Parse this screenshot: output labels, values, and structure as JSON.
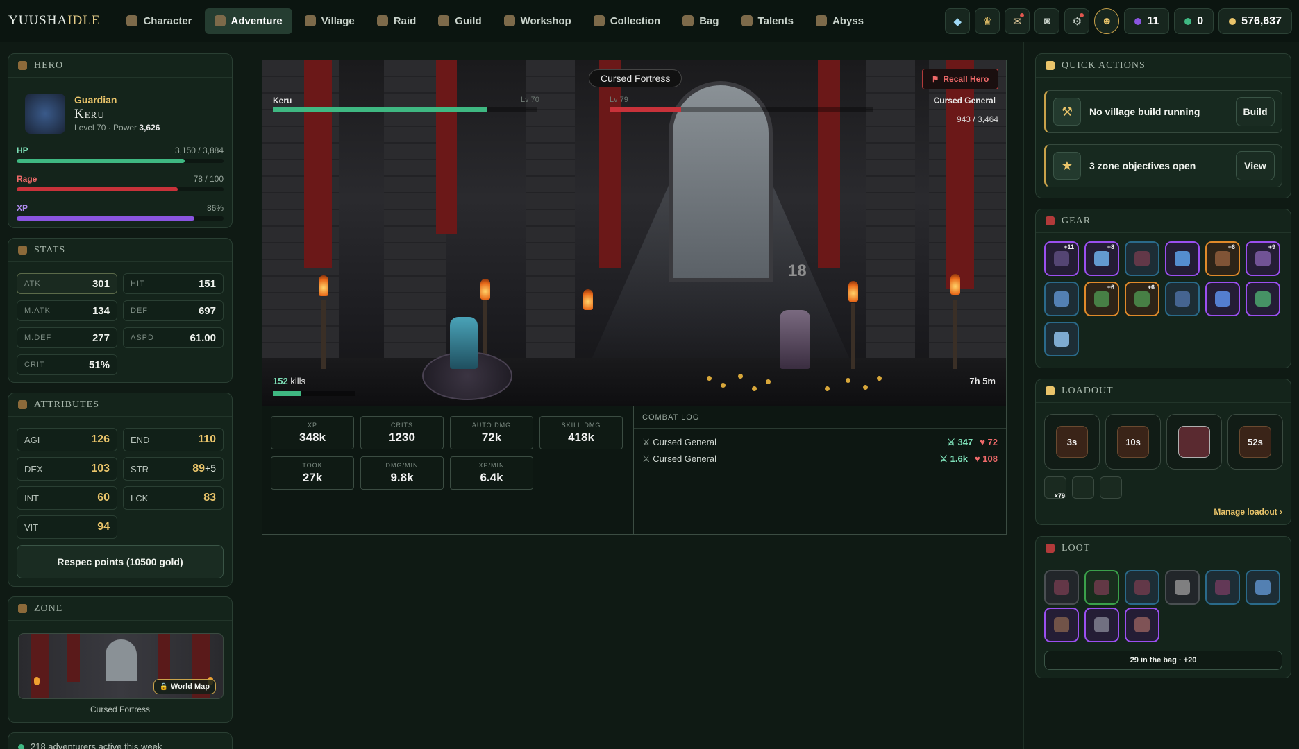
{
  "nav": {
    "logo_main": "YUUSHA",
    "logo_accent": "IDLE",
    "items": [
      {
        "label": "Character",
        "icon": "character-icon"
      },
      {
        "label": "Adventure",
        "icon": "sword-icon",
        "active": true
      },
      {
        "label": "Village",
        "icon": "hammer-icon"
      },
      {
        "label": "Raid",
        "icon": "skull-icon"
      },
      {
        "label": "Guild",
        "icon": "shield-icon"
      },
      {
        "label": "Workshop",
        "icon": "anvil-icon"
      },
      {
        "label": "Collection",
        "icon": "book-icon"
      },
      {
        "label": "Bag",
        "icon": "bag-icon"
      },
      {
        "label": "Talents",
        "icon": "tree-icon"
      },
      {
        "label": "Abyss",
        "icon": "portal-icon"
      }
    ],
    "right": {
      "icons": [
        "diamond-icon",
        "trophy-icon",
        "mail-icon",
        "discord-icon",
        "settings-icon",
        "avatar-icon"
      ],
      "crystals": "11",
      "gems": "0",
      "gold": "576,637"
    }
  },
  "hero": {
    "section_title": "HERO",
    "class": "Guardian",
    "name": "Keru",
    "level_text": "Level 70 · Power",
    "power": "3,626",
    "hp_label": "HP",
    "hp_value": "3,150 / 3,884",
    "hp_fraction": 0.811,
    "rage_label": "Rage",
    "rage_value": "78 / 100",
    "rage_fraction": 0.78,
    "xp_label": "XP",
    "xp_value": "86%",
    "xp_fraction": 0.86
  },
  "stats": {
    "section_title": "STATS",
    "items": [
      {
        "k": "ATK",
        "v": "301"
      },
      {
        "k": "HIT",
        "v": "151"
      },
      {
        "k": "M.ATK",
        "v": "134"
      },
      {
        "k": "DEF",
        "v": "697"
      },
      {
        "k": "M.DEF",
        "v": "277"
      },
      {
        "k": "ASPD",
        "v": "61.00"
      },
      {
        "k": "CRIT",
        "v": "51%"
      }
    ]
  },
  "attributes": {
    "section_title": "ATTRIBUTES",
    "items": [
      {
        "k": "AGI",
        "v": "126"
      },
      {
        "k": "END",
        "v": "110"
      },
      {
        "k": "DEX",
        "v": "103"
      },
      {
        "k": "STR",
        "v": "89",
        "bonus": "+5"
      },
      {
        "k": "INT",
        "v": "60"
      },
      {
        "k": "LCK",
        "v": "83"
      },
      {
        "k": "VIT",
        "v": "94"
      }
    ],
    "respec_label": "Respec points (10500 gold)"
  },
  "zone": {
    "section_title": "ZONE",
    "world_map_label": "World Map",
    "zone_name": "Cursed Fortress"
  },
  "footer_note": "218 adventurers active this week",
  "battle": {
    "zone_title": "Cursed Fortress",
    "recall_label": "Recall Hero",
    "hero_name": "Keru",
    "hero_level": "Lv 70",
    "hero_hp_fraction": 0.811,
    "enemy_level": "Lv 79",
    "enemy_name": "Cursed General",
    "enemy_hp_text": "943 / 3,464",
    "enemy_hp_fraction": 0.272,
    "damage_number": "18",
    "kills_count": "152",
    "kills_suffix": "kills",
    "kills_fraction": 0.34,
    "time_left": "7h 5m"
  },
  "session_stats": [
    {
      "k": "XP",
      "v": "348k"
    },
    {
      "k": "CRITS",
      "v": "1230"
    },
    {
      "k": "AUTO DMG",
      "v": "72k"
    },
    {
      "k": "SKILL DMG",
      "v": "418k"
    },
    {
      "k": "TOOK",
      "v": "27k"
    },
    {
      "k": "DMG/MIN",
      "v": "9.8k"
    },
    {
      "k": "XP/MIN",
      "v": "6.4k"
    }
  ],
  "combat_log": {
    "title": "COMBAT LOG",
    "rows": [
      {
        "name": "Cursed General",
        "dmg": "347",
        "heal": "72"
      },
      {
        "name": "Cursed General",
        "dmg": "1.6k",
        "heal": "108"
      }
    ]
  },
  "quick_actions": {
    "section_title": "QUICK ACTIONS",
    "items": [
      {
        "text": "No village build running",
        "button": "Build",
        "icon": "anvil-icon"
      },
      {
        "text": "3 zone objectives open",
        "button": "View",
        "icon": "medal-icon"
      }
    ]
  },
  "gear": {
    "section_title": "GEAR",
    "slots": [
      {
        "rarity": "purple",
        "plus": "+11",
        "icon": "orb-icon",
        "color": "#5a4a7a"
      },
      {
        "rarity": "purple",
        "plus": "+8",
        "icon": "crystal-shield-icon",
        "color": "#6aa8e0"
      },
      {
        "rarity": "blue",
        "plus": "",
        "icon": "helmet-icon",
        "color": "#6a3a4a"
      },
      {
        "rarity": "purple",
        "plus": "",
        "icon": "gauntlets-icon",
        "color": "#5a9ae0"
      },
      {
        "rarity": "orange",
        "plus": "+6",
        "icon": "armor-icon",
        "color": "#8a5a3a"
      },
      {
        "rarity": "purple",
        "plus": "+9",
        "icon": "greaves-icon",
        "color": "#7a5aa0"
      },
      {
        "rarity": "blue",
        "plus": "",
        "icon": "snowflake-icon",
        "color": "#5a8ac0"
      },
      {
        "rarity": "orange",
        "plus": "+6",
        "icon": "ring-icon",
        "color": "#4a8a4a"
      },
      {
        "rarity": "orange",
        "plus": "+6",
        "icon": "amulet-icon",
        "color": "#4a8a4a"
      },
      {
        "rarity": "blue",
        "plus": "",
        "icon": "cape-icon",
        "color": "#4a6a9a"
      },
      {
        "rarity": "purple",
        "plus": "",
        "icon": "boots-icon",
        "color": "#5a8ae0"
      },
      {
        "rarity": "purple",
        "plus": "",
        "icon": "emerald-icon",
        "color": "#4aa06a"
      },
      {
        "rarity": "blue",
        "plus": "",
        "icon": "frost-orb-icon",
        "color": "#8ab8e0"
      }
    ]
  },
  "loadout": {
    "section_title": "LOADOUT",
    "slots": [
      {
        "label": "3s",
        "icon": "fire-skill-icon"
      },
      {
        "label": "10s",
        "icon": "strike-skill-icon"
      },
      {
        "label": "",
        "icon": "shield-skill-icon"
      },
      {
        "label": "52s",
        "icon": "ultimate-skill-icon"
      }
    ],
    "consumables": [
      {
        "icon": "potion-icon",
        "count": "×79"
      },
      {
        "icon": "elixir-icon",
        "count": ""
      },
      {
        "icon": "elixir-icon",
        "count": ""
      }
    ],
    "manage_label": "Manage loadout ›"
  },
  "loot": {
    "section_title": "LOOT",
    "slots": [
      {
        "rarity": "grey",
        "icon": "helmet-icon",
        "color": "#6a3a4a"
      },
      {
        "rarity": "green",
        "icon": "greaves-icon",
        "color": "#6a3a4a"
      },
      {
        "rarity": "blue",
        "icon": "armor-icon",
        "color": "#6a3a4a"
      },
      {
        "rarity": "grey",
        "icon": "sword-icon",
        "color": "#8a8a8a"
      },
      {
        "rarity": "blue",
        "icon": "greaves-icon",
        "color": "#6a3a5a"
      },
      {
        "rarity": "blue",
        "icon": "snowflake-icon",
        "color": "#5a8ac0"
      },
      {
        "rarity": "purple",
        "icon": "tome-icon",
        "color": "#7a5a4a"
      },
      {
        "rarity": "purple",
        "icon": "legs-icon",
        "color": "#7a7a8a"
      },
      {
        "rarity": "purple",
        "icon": "dagger-icon",
        "color": "#8a5a5a"
      }
    ],
    "bag_summary": "29 in the bag · +20"
  },
  "colors": {
    "accent_gold": "#e9c46a",
    "hp_green": "#3fb882",
    "rage_red": "#c8323a",
    "xp_purple": "#8a55e0",
    "enemy_red": "#c8323a"
  }
}
